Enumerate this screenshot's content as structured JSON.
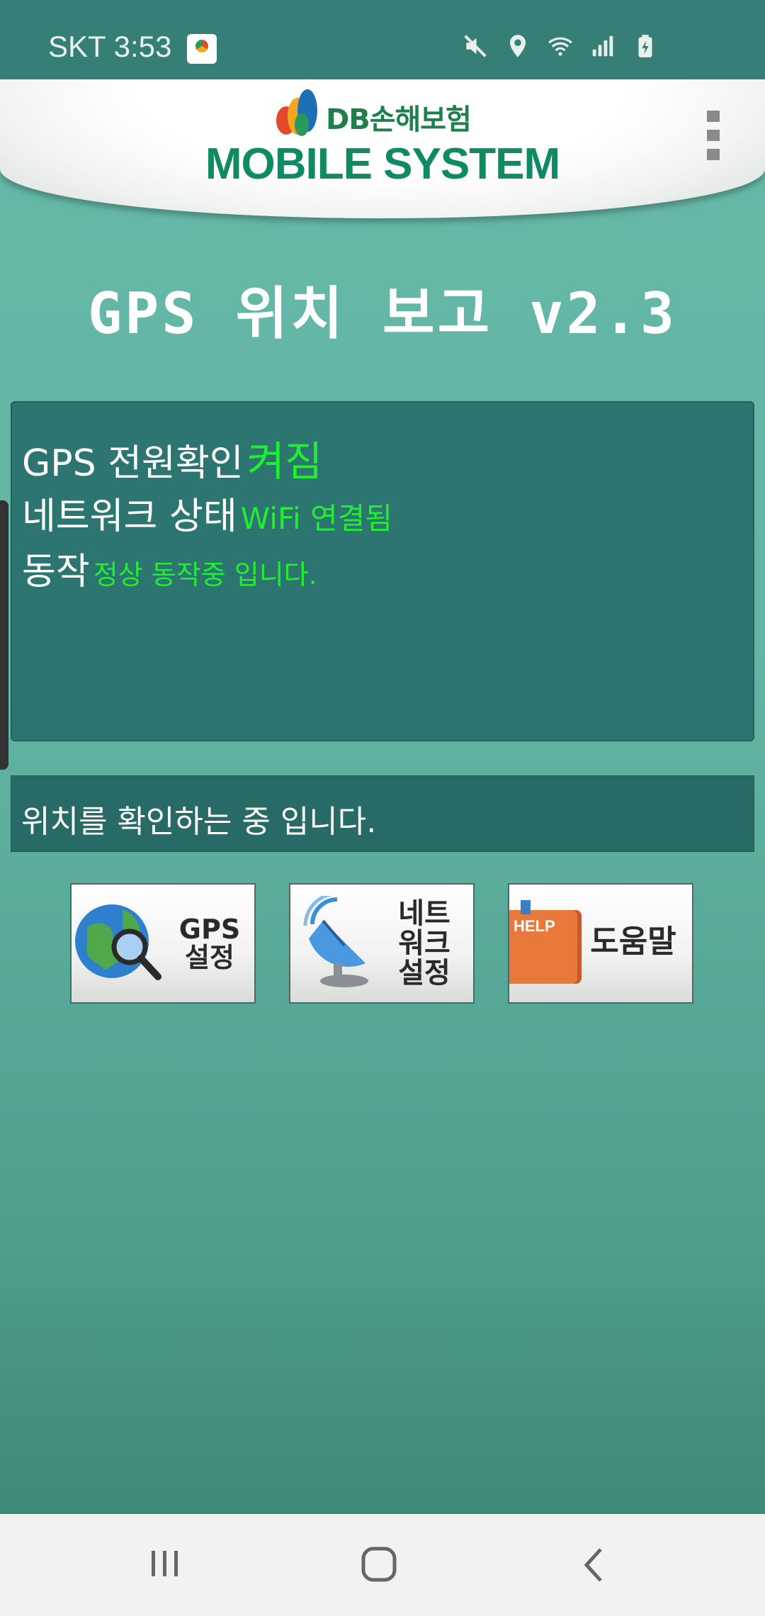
{
  "status_bar": {
    "carrier_time": "SKT 3:53",
    "icons": [
      "mute-icon",
      "location-icon",
      "wifi-icon",
      "signal-icon",
      "battery-charging-icon"
    ]
  },
  "header": {
    "company": "DB손해보험",
    "system_name": "MOBILE SYSTEM"
  },
  "app_title": "GPS 위치 보고 v2.3",
  "status_panel": {
    "gps_label": "GPS 전원확인",
    "gps_value": "켜짐",
    "network_label": "네트워크 상태",
    "network_value": "WiFi 연결됨",
    "operation_label": "동작",
    "operation_value": "정상 동작중 입니다."
  },
  "message": "위치를 확인하는 중 입니다.",
  "buttons": {
    "gps_settings": [
      "GPS",
      "설정"
    ],
    "network_settings": [
      "네트",
      "워크",
      "설정"
    ],
    "help_badge": "HELP",
    "help_label": "도움말"
  },
  "colors": {
    "status_value": "#1fef2f",
    "panel_bg": "#2d7570",
    "brand_green": "#0f8a63"
  }
}
